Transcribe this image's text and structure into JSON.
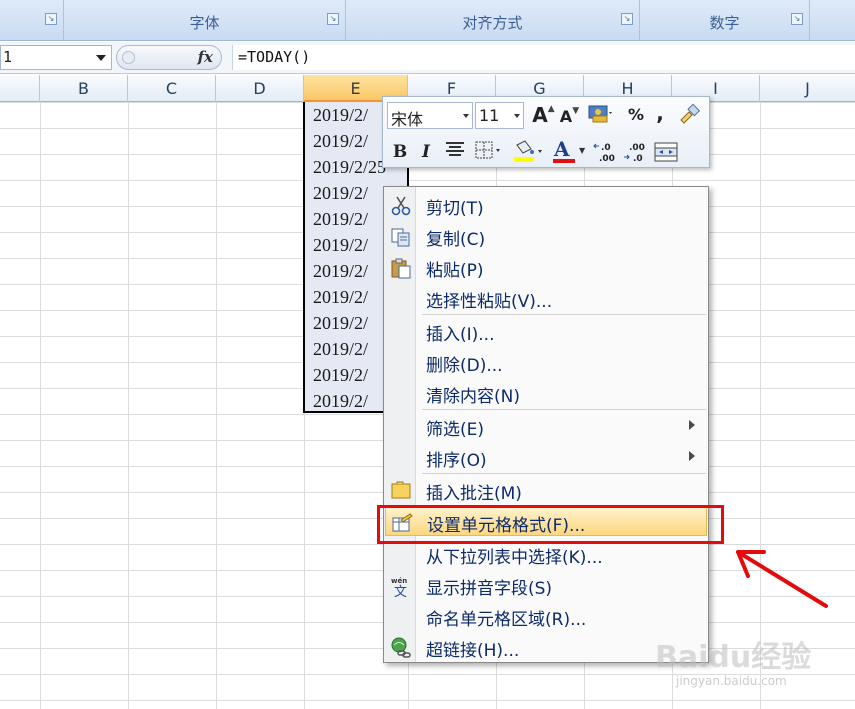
{
  "ribbon": {
    "groups": [
      {
        "label": ""
      },
      {
        "label": "字体"
      },
      {
        "label": "对齐方式"
      },
      {
        "label": "数字"
      },
      {
        "label": ""
      }
    ]
  },
  "formula_bar": {
    "name_box_value": "1",
    "fx_label": "fx",
    "formula": "=TODAY()"
  },
  "columns": [
    "B",
    "C",
    "D",
    "E",
    "F",
    "G",
    "H",
    "I",
    "J"
  ],
  "selected_column": "E",
  "cells": [
    "2019/2/",
    "2019/2/",
    "2019/2/25",
    "2019/2/",
    "2019/2/",
    "2019/2/",
    "2019/2/",
    "2019/2/",
    "2019/2/",
    "2019/2/",
    "2019/2/",
    "2019/2/"
  ],
  "mini_toolbar": {
    "font_name": "宋体",
    "font_size": "11",
    "grow_font": "A",
    "shrink_font": "A",
    "percent": "%",
    "comma": ",",
    "bold": "B",
    "italic": "I",
    "font_color_letter": "A",
    "increase_decimal": "+.0\n.00",
    "decrease_decimal": ".00\n→.0"
  },
  "context_menu": {
    "items": [
      {
        "label": "剪切(T)",
        "icon": "scissors-icon"
      },
      {
        "label": "复制(C)",
        "icon": "copy-icon"
      },
      {
        "label": "粘贴(P)",
        "icon": "paste-icon"
      },
      {
        "label": "选择性粘贴(V)...",
        "icon": ""
      },
      {
        "label": "插入(I)...",
        "icon": ""
      },
      {
        "label": "删除(D)...",
        "icon": ""
      },
      {
        "label": "清除内容(N)",
        "icon": ""
      },
      {
        "label": "筛选(E)",
        "icon": "",
        "submenu": true
      },
      {
        "label": "排序(O)",
        "icon": "",
        "submenu": true
      },
      {
        "label": "插入批注(M)",
        "icon": "comment-icon"
      },
      {
        "label": "设置单元格格式(F)...",
        "icon": "format-cells-icon",
        "highlighted": true
      },
      {
        "label": "从下拉列表中选择(K)...",
        "icon": ""
      },
      {
        "label": "显示拼音字段(S)",
        "icon": "pinyin-icon"
      },
      {
        "label": "命名单元格区域(R)...",
        "icon": ""
      },
      {
        "label": "超链接(H)...",
        "icon": "hyperlink-icon"
      }
    ]
  },
  "watermark": {
    "brand": "Baidu经验",
    "url": "jingyan.baidu.com"
  },
  "colors": {
    "highlight_box": "#e30b0b",
    "menu_text": "#0d2b6b",
    "selected_header": "#f9c865"
  }
}
